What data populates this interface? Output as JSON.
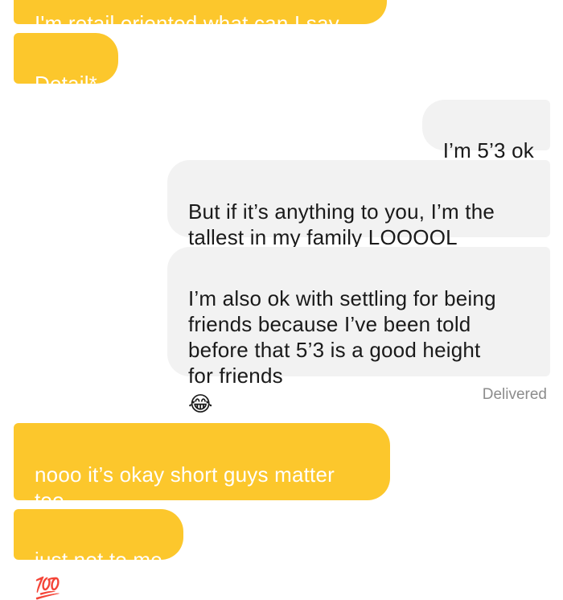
{
  "messages": [
    {
      "id": "m0",
      "text": "I'm retail oriented what can I say"
    },
    {
      "id": "m1",
      "text": "Detail*"
    },
    {
      "id": "m2",
      "text": "I’m 5’3 ok",
      "emoji": "✋🏼😌"
    },
    {
      "id": "m3",
      "text": "But if it’s anything to you, I’m the\ntallest in my family LOOOOL"
    },
    {
      "id": "m4",
      "text": "I’m also ok with settling for being\nfriends because I’ve been told\nbefore that 5’3 is a good height\nfor friends",
      "emoji": "😂"
    },
    {
      "id": "m5",
      "text": "nooo it’s okay short guys matter\ntoo",
      "emoji": "😌"
    },
    {
      "id": "m6",
      "text": "just not to me",
      "emoji": "💯"
    }
  ],
  "status": {
    "delivered": "Delivered"
  },
  "colors": {
    "sent_bubble": "#fcc72c",
    "received_bubble": "#f2f2f2",
    "sent_text": "#ffffff",
    "received_text": "#1a1a1a",
    "status_text": "#8c8c8c"
  }
}
